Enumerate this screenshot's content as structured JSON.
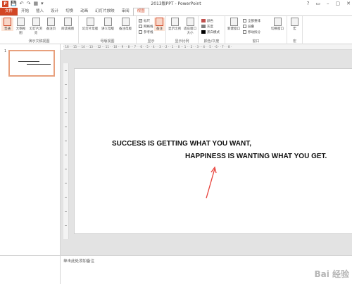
{
  "titlebar": {
    "app_icon": "P",
    "title": "2013版PPT - PowerPoint",
    "qat": [
      "💾",
      "↶",
      "↷",
      "▦",
      "▾"
    ],
    "window_controls": [
      "?",
      "▭",
      "–",
      "▢",
      "✕"
    ]
  },
  "tabs": [
    "文件",
    "开始",
    "插入",
    "设计",
    "切换",
    "动画",
    "幻灯片放映",
    "审阅",
    "视图"
  ],
  "active_tab": "视图",
  "ribbon": {
    "presentation_views": {
      "label": "演示文稿视图",
      "buttons": [
        "普通",
        "大纲视图",
        "幻灯片浏览",
        "备注页",
        "阅读视图"
      ],
      "selected": "普通"
    },
    "master_views": {
      "label": "母版视图",
      "buttons": [
        "幻灯片母版",
        "讲义母版",
        "备注母版"
      ]
    },
    "show": {
      "label": "显示",
      "checks": [
        {
          "label": "标尺",
          "checked": true
        },
        {
          "label": "网格线",
          "checked": false
        },
        {
          "label": "参考线",
          "checked": false
        }
      ],
      "notes_button": "备注"
    },
    "zoom": {
      "label": "显示比例",
      "buttons": [
        "显示比例",
        "适应窗口大小"
      ]
    },
    "color": {
      "label": "颜色/灰度",
      "items": [
        "颜色",
        "灰度",
        "黑白模式"
      ],
      "swatch_colors": [
        "#c0504d",
        "#7f7f7f",
        "#000000"
      ]
    },
    "window": {
      "label": "窗口",
      "new_window": "新建窗口",
      "items": [
        "全部重排",
        "层叠",
        "移动拆分"
      ],
      "switch": "切换窗口"
    },
    "macro": {
      "label": "宏",
      "button": "宏"
    }
  },
  "ruler_text": "· 16 · · 15 · · 14 · · 13 · · 12 · · 11 · · 10 · · 9 · · 8 · · 7 · · 6 · · 5 · · 4 · · 3 · · 2 · · 1 · · 0 · · 1 · · 2 · · 3 · · 4 · · 5 · · 6 · · 7 · · 8 ·",
  "thumbnail": {
    "number": "1"
  },
  "slide": {
    "line1": "SUCCESS IS GETTING WHAT YOU WANT,",
    "line2": "HAPPINESS IS WANTING WHAT YOU GET."
  },
  "notes_placeholder": "单击此处添加备注",
  "watermark": "Bai 经验"
}
